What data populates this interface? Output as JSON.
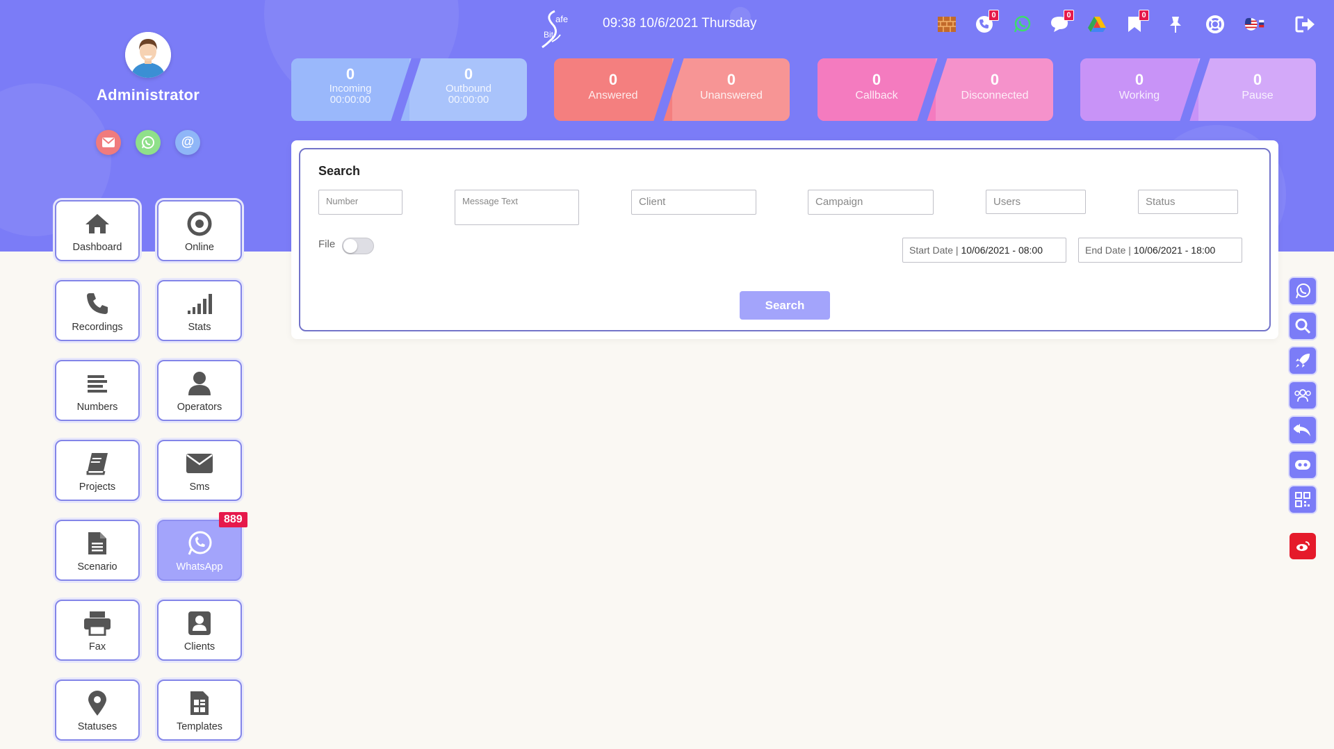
{
  "user": {
    "name": "Administrator"
  },
  "header": {
    "logo_text_top": "afe",
    "logo_text_bottom": "Bit",
    "datetime": "09:38 10/6/2021 Thursday",
    "icons": [
      {
        "name": "brick-wall-icon",
        "badge": ""
      },
      {
        "name": "phone-icon",
        "badge": "0"
      },
      {
        "name": "whatsapp-icon",
        "badge": ""
      },
      {
        "name": "chat-icon",
        "badge": "0"
      },
      {
        "name": "drive-icon",
        "badge": ""
      },
      {
        "name": "bookmark-icon",
        "badge": "0"
      },
      {
        "name": "pin-icon",
        "badge": ""
      },
      {
        "name": "lifebuoy-icon",
        "badge": ""
      },
      {
        "name": "language-flag-icon",
        "badge": ""
      },
      {
        "name": "logout-icon",
        "badge": ""
      }
    ]
  },
  "stats": {
    "incoming": {
      "value": "0",
      "label": "Incoming",
      "time": "00:00:00"
    },
    "outbound": {
      "value": "0",
      "label": "Outbound",
      "time": "00:00:00"
    },
    "answered": {
      "value": "0",
      "label": "Answered"
    },
    "unanswered": {
      "value": "0",
      "label": "Unanswered"
    },
    "callback": {
      "value": "0",
      "label": "Callback"
    },
    "disconnected": {
      "value": "0",
      "label": "Disconnected"
    },
    "working": {
      "value": "0",
      "label": "Working"
    },
    "pause": {
      "value": "0",
      "label": "Pause"
    }
  },
  "nav": {
    "dashboard": "Dashboard",
    "online": "Online",
    "recordings": "Recordings",
    "stats": "Stats",
    "numbers": "Numbers",
    "operators": "Operators",
    "projects": "Projects",
    "sms": "Sms",
    "scenario": "Scenario",
    "whatsapp": "WhatsApp",
    "whatsapp_badge": "889",
    "fax": "Fax",
    "clients": "Clients",
    "statuses": "Statuses",
    "templates": "Templates"
  },
  "search": {
    "title": "Search",
    "number_placeholder": "Number",
    "message_placeholder": "Message Text",
    "client_placeholder": "Client",
    "campaign_placeholder": "Campaign",
    "users_placeholder": "Users",
    "status_placeholder": "Status",
    "file_label": "File",
    "start_label": "Start Date",
    "start_value": "10/06/2021 - 08:00",
    "end_label": "End Date",
    "end_value": "10/06/2021 - 18:00",
    "button_label": "Search"
  },
  "colors": {
    "brand": "#7b7cf7",
    "blue_card": "#9ab8fb",
    "red_card": "#f47f7f",
    "pink_card": "#f47bbf",
    "purple_card": "#c893f7",
    "badge_red": "#e6194b"
  }
}
